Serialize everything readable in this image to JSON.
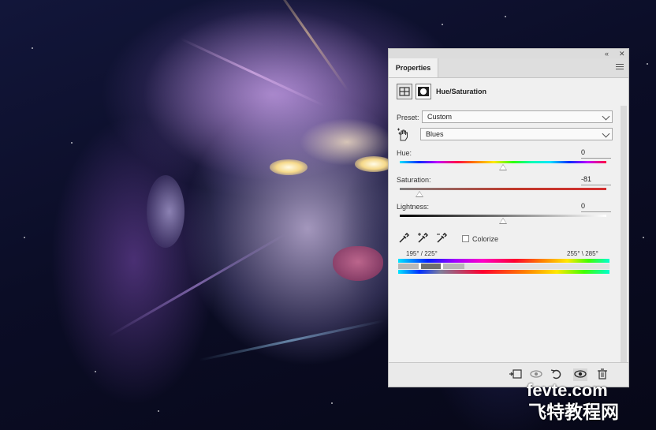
{
  "panel": {
    "tab_label": "Properties",
    "collapse_icon": "double-chevron-icon",
    "close_icon": "close-icon",
    "menu_icon": "panel-menu-icon",
    "adjustment_title": "Hue/Saturation",
    "preset_label": "Preset:",
    "preset_value": "Custom",
    "channel_value": "Blues",
    "hue": {
      "label": "Hue:",
      "value": "0",
      "position": 0.5
    },
    "saturation": {
      "label": "Saturation:",
      "value": "-81",
      "position": 0.095
    },
    "lightness": {
      "label": "Lightness:",
      "value": "0",
      "position": 0.5
    },
    "colorize_label": "Colorize",
    "colorize_checked": false,
    "range_left": "195° / 225°",
    "range_right": "255° \\ 285°",
    "bottom_buttons": [
      "clip-to-layer-icon",
      "view-previous-state-icon",
      "reset-icon",
      "visibility-eye-icon",
      "trash-icon"
    ]
  },
  "watermark": {
    "line1": "fevte.com",
    "line2": "飞特教程网"
  },
  "colors": {
    "panel_bg": "#f0f0f0",
    "saturation_track": "#c0392b"
  }
}
